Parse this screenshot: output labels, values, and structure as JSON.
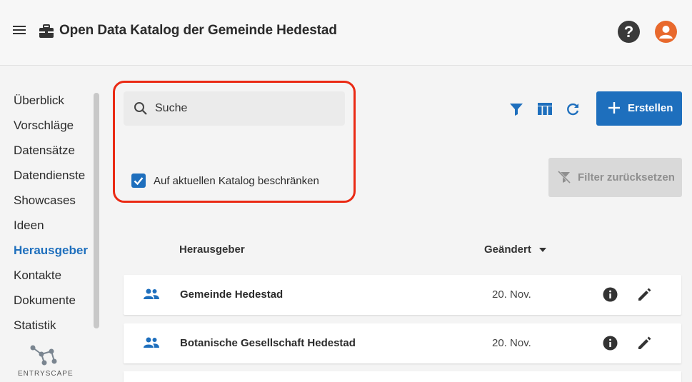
{
  "header": {
    "title": "Open Data Katalog der Gemeinde Hedestad",
    "help_label": "?"
  },
  "sidebar": {
    "items": [
      {
        "label": "Überblick",
        "active": false
      },
      {
        "label": "Vorschläge",
        "active": false
      },
      {
        "label": "Datensätze",
        "active": false
      },
      {
        "label": "Datendienste",
        "active": false
      },
      {
        "label": "Showcases",
        "active": false
      },
      {
        "label": "Ideen",
        "active": false
      },
      {
        "label": "Herausgeber",
        "active": true
      },
      {
        "label": "Kontakte",
        "active": false
      },
      {
        "label": "Dokumente",
        "active": false
      },
      {
        "label": "Statistik",
        "active": false
      }
    ],
    "brand": "ENTRYSCAPE"
  },
  "search": {
    "placeholder": "Suche",
    "value": ""
  },
  "filter": {
    "restrict_label": "Auf aktuellen Katalog beschränken",
    "restrict_checked": true,
    "reset_label": "Filter zurücksetzen"
  },
  "toolbar": {
    "create_label": "Erstellen"
  },
  "table": {
    "columns": [
      "Herausgeber",
      "Geändert"
    ],
    "rows": [
      {
        "name": "Gemeinde Hedestad",
        "changed": "20. Nov."
      },
      {
        "name": "Botanische Gesellschaft Hedestad",
        "changed": "20. Nov."
      }
    ]
  },
  "colors": {
    "accent": "#1e6fbd",
    "highlight": "#ea2a14",
    "avatar": "#e8692d"
  }
}
